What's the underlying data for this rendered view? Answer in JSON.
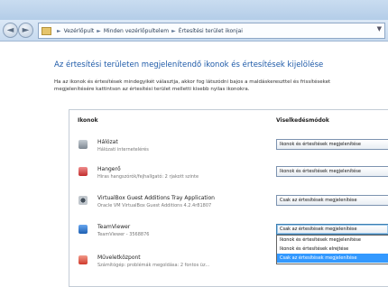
{
  "nav": {
    "back_glyph": "◄",
    "forward_glyph": "►"
  },
  "address": {
    "crumbs": [
      "Vezérlőpult",
      "Minden vezérlőpultelem",
      "Értesítési terület ikonjai"
    ],
    "separator": "►",
    "dropdown_glyph": "▼"
  },
  "page": {
    "heading": "Az értesítési területen megjelenítendő ikonok és értesítések kijelölése",
    "description_line1": "Ha az ikonok és értesítések mindegyikét választja, akkor fog látszódni bajos a maldáskereszttel és frissítéseket",
    "description_line2": "megjelenítésére kattintson az értesítési terület melletti kisebb nyilas ikonokra."
  },
  "table": {
    "col_icons": "Ikonok",
    "col_behavior": "Viselkedésmódok",
    "rows": [
      {
        "name": "Hálózat",
        "sub": "Hálózati internetelérés",
        "icon": "network-icon",
        "behavior": "Ikonok és értesítések megjelenítése"
      },
      {
        "name": "Hangerő",
        "sub": "Hiras hangszórók/fejhallgató: 2 rjakott szinte",
        "icon": "volume-icon",
        "behavior": "Ikonok és értesítések megjelenítése"
      },
      {
        "name": "VirtualBox Guest Additions Tray Application",
        "sub": "Oracle VM VirtualBox Guest Additions 4.2.4r81807",
        "icon": "virtualbox-icon",
        "behavior": "Csak az értesítések megjelenítése"
      },
      {
        "name": "TeamViewer",
        "sub": "TeamViewer - 3568876",
        "icon": "teamviewer-icon",
        "behavior": "Csak az értesítések megjelenítése"
      },
      {
        "name": "Műveletközpont",
        "sub": "Számítógép: problémák megoldása: 2 fontos üz...",
        "icon": "action-center-icon",
        "behavior": ""
      }
    ],
    "dropdown_options": [
      "Ikonok és értesítések megjelenítése",
      "Ikonok és értesítések elrejtése",
      "Csak az értesítések megjelenítése"
    ],
    "dropdown_highlighted": "Csak az értesítések megjelenítése"
  }
}
